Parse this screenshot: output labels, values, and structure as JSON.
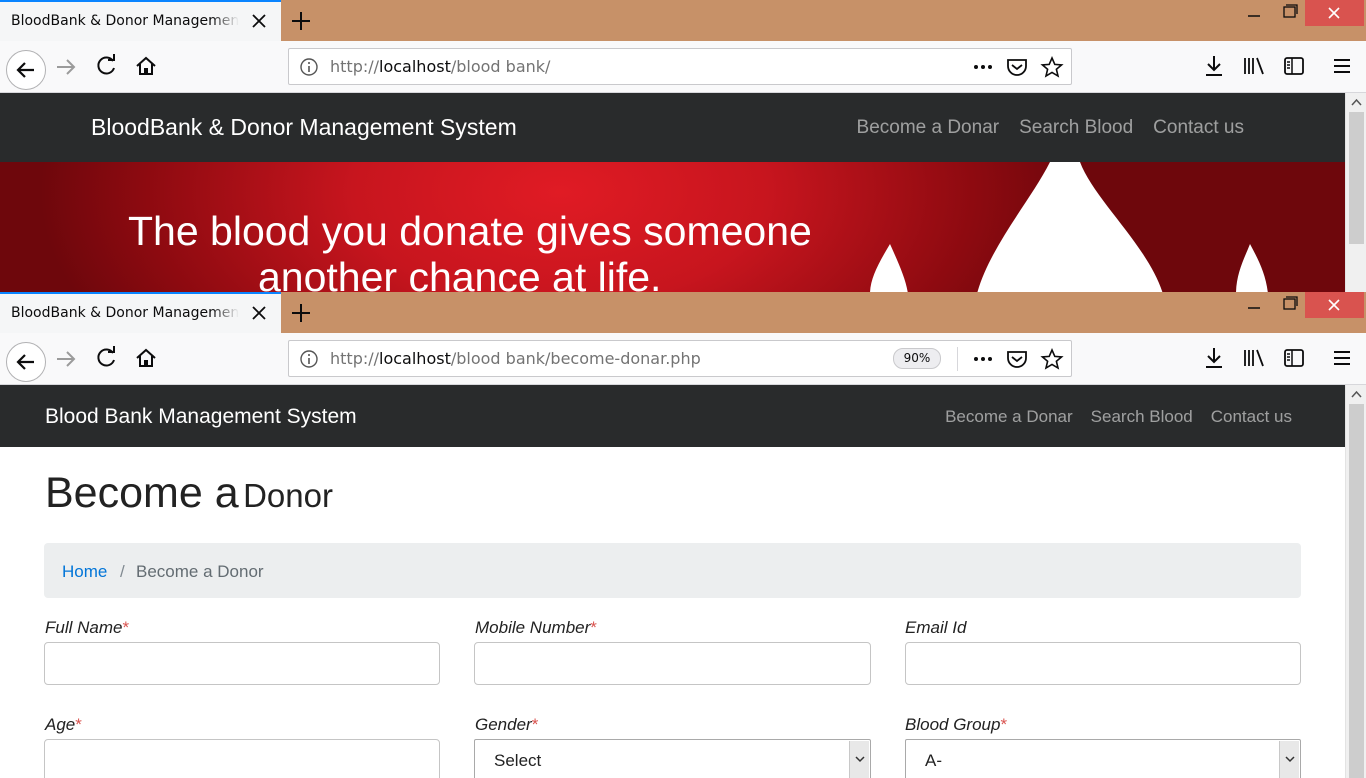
{
  "window1": {
    "tab_title": "BloodBank & Donor Management System",
    "url_scheme": "http://",
    "url_host": "localhost",
    "url_path": "/blood bank/",
    "site": {
      "brand": "BloodBank & Donor Management System",
      "nav": [
        "Become a Donar",
        "Search Blood",
        "Contact us"
      ],
      "hero_line1": "The blood you donate gives someone",
      "hero_line2": "another chance at life."
    }
  },
  "window2": {
    "tab_title": "BloodBank & Donor Management System",
    "url_scheme": "http://",
    "url_host": "localhost",
    "url_path": "/blood bank/become-donar.php",
    "zoom": "90%",
    "site": {
      "brand": "Blood Bank Management System",
      "nav": [
        "Become a Donar",
        "Search Blood",
        "Contact us"
      ],
      "title_big": "Become a",
      "title_small": "Donor",
      "breadcrumb": {
        "home": "Home",
        "separator": "/",
        "current": "Become a Donor"
      },
      "form": {
        "required_mark": "*",
        "full_name_label": "Full Name",
        "mobile_label": "Mobile Number",
        "email_label": "Email Id",
        "age_label": "Age",
        "gender_label": "Gender",
        "gender_value": "Select",
        "blood_group_label": "Blood Group",
        "blood_group_value": "A-"
      }
    }
  },
  "colors": {
    "tab_strip": "#c79168",
    "site_nav": "#292b2c",
    "link_blue": "#0275d8",
    "required": "#d9534f",
    "hero_red": "#c7151e"
  },
  "icons": [
    "close-icon",
    "plus-icon",
    "minimize-icon",
    "maximize-icon",
    "back-arrow-icon",
    "forward-arrow-icon",
    "reload-icon",
    "home-icon",
    "info-icon",
    "more-icon",
    "pocket-icon",
    "star-icon",
    "download-icon",
    "library-icon",
    "sidebar-icon",
    "menu-icon",
    "chevron-up-icon",
    "chevron-down-icon",
    "blood-drop-icon"
  ]
}
